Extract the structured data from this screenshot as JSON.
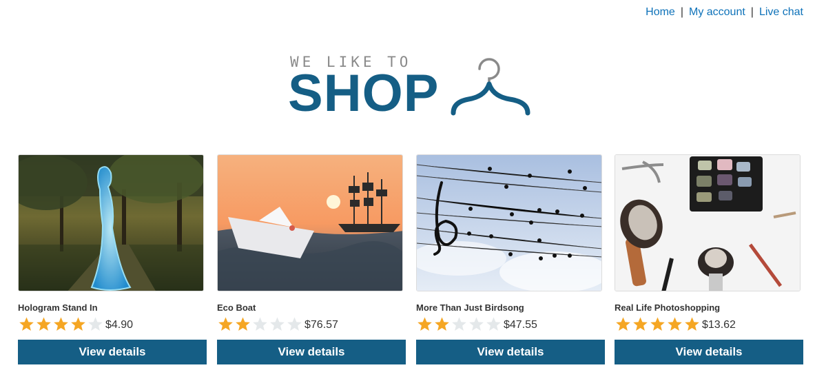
{
  "nav": {
    "home": "Home",
    "account": "My account",
    "chat": "Live chat",
    "separator": "|"
  },
  "logo": {
    "tagline": "WE LIKE TO",
    "word": "SHOP",
    "icon": "hanger-icon",
    "color": "#155e85"
  },
  "colors": {
    "accent": "#155e85",
    "link": "#0e72b9",
    "star_on": "#f5a623",
    "star_off": "#e4e8ea"
  },
  "products": [
    {
      "name": "Hologram Stand In",
      "rating": 4,
      "max_rating": 5,
      "price": "$4.90",
      "button": "View details",
      "image": "hologram-woman-park-image"
    },
    {
      "name": "Eco Boat",
      "rating": 2,
      "max_rating": 5,
      "price": "$76.57",
      "button": "View details",
      "image": "paper-boat-sunset-image"
    },
    {
      "name": "More Than Just Birdsong",
      "rating": 2,
      "max_rating": 5,
      "price": "$47.55",
      "button": "View details",
      "image": "birds-on-wires-music-image"
    },
    {
      "name": "Real Life Photoshopping",
      "rating": 5,
      "max_rating": 5,
      "price": "$13.62",
      "button": "View details",
      "image": "makeup-brushes-image"
    }
  ]
}
